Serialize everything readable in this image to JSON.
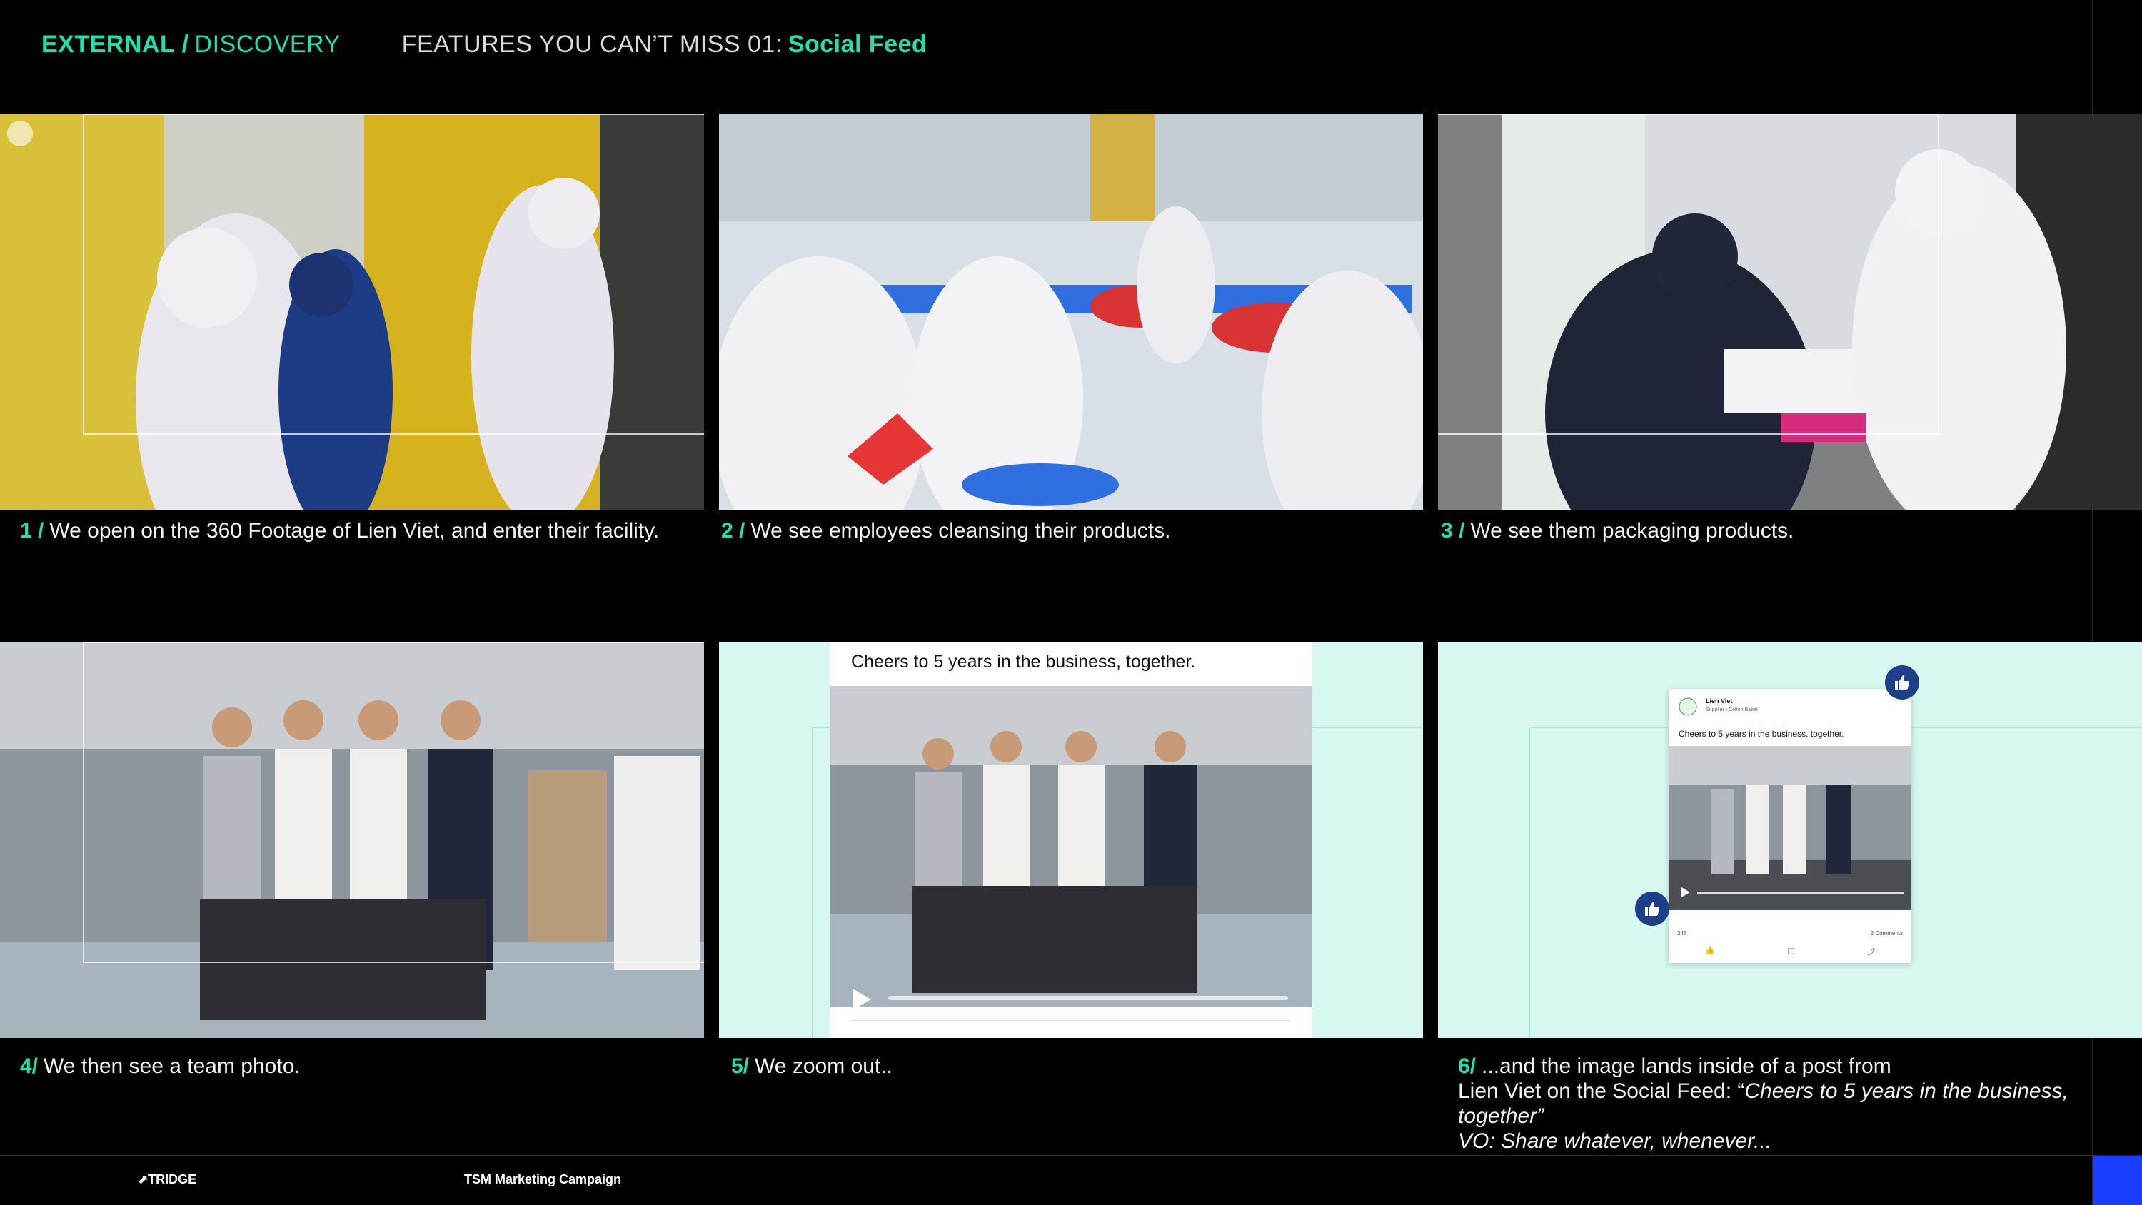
{
  "header": {
    "section": "EXTERNAL /",
    "subsection": "DISCOVERY",
    "feature_prefix": "FEATURES YOU CAN’T MISS 01:",
    "feature_name": "Social Feed"
  },
  "captions": [
    {
      "num": "1 /",
      "text": "We open on the 360 Footage of Lien Viet, and enter their facility."
    },
    {
      "num": "2 /",
      "text": "We see employees cleansing their products."
    },
    {
      "num": "3 /",
      "text": "We see them packaging products."
    },
    {
      "num": "4/",
      "text": "We then see a team photo."
    },
    {
      "num": "5/",
      "text": "We zoom out.."
    },
    {
      "num": "6/",
      "text_line1": "...and the image lands inside of a post from",
      "text_line2": "Lien Viet on the Social Feed: “",
      "quote": "Cheers to 5 years in the business, together",
      "quote_end": "”",
      "vo": "VO: Share whatever, whenever..."
    }
  ],
  "post": {
    "text": "Cheers to 5 years in the business, together.",
    "author": "Lien Viet",
    "subtitle": "Supplier • Cotton Babel",
    "likes": "348",
    "comments": "2 Comments"
  },
  "footer": {
    "logo": "TRIDGE",
    "campaign": "TSM Marketing Campaign"
  },
  "icons": {
    "play": "play-icon",
    "like": "thumbs-up-icon",
    "logo_mark": "tridge-arrow-icon"
  },
  "colors": {
    "accent": "#1fe0b0",
    "panel_bg": "#d6f8f0",
    "like_badge": "#1d3f8a",
    "corner_block": "#1a3cff"
  }
}
